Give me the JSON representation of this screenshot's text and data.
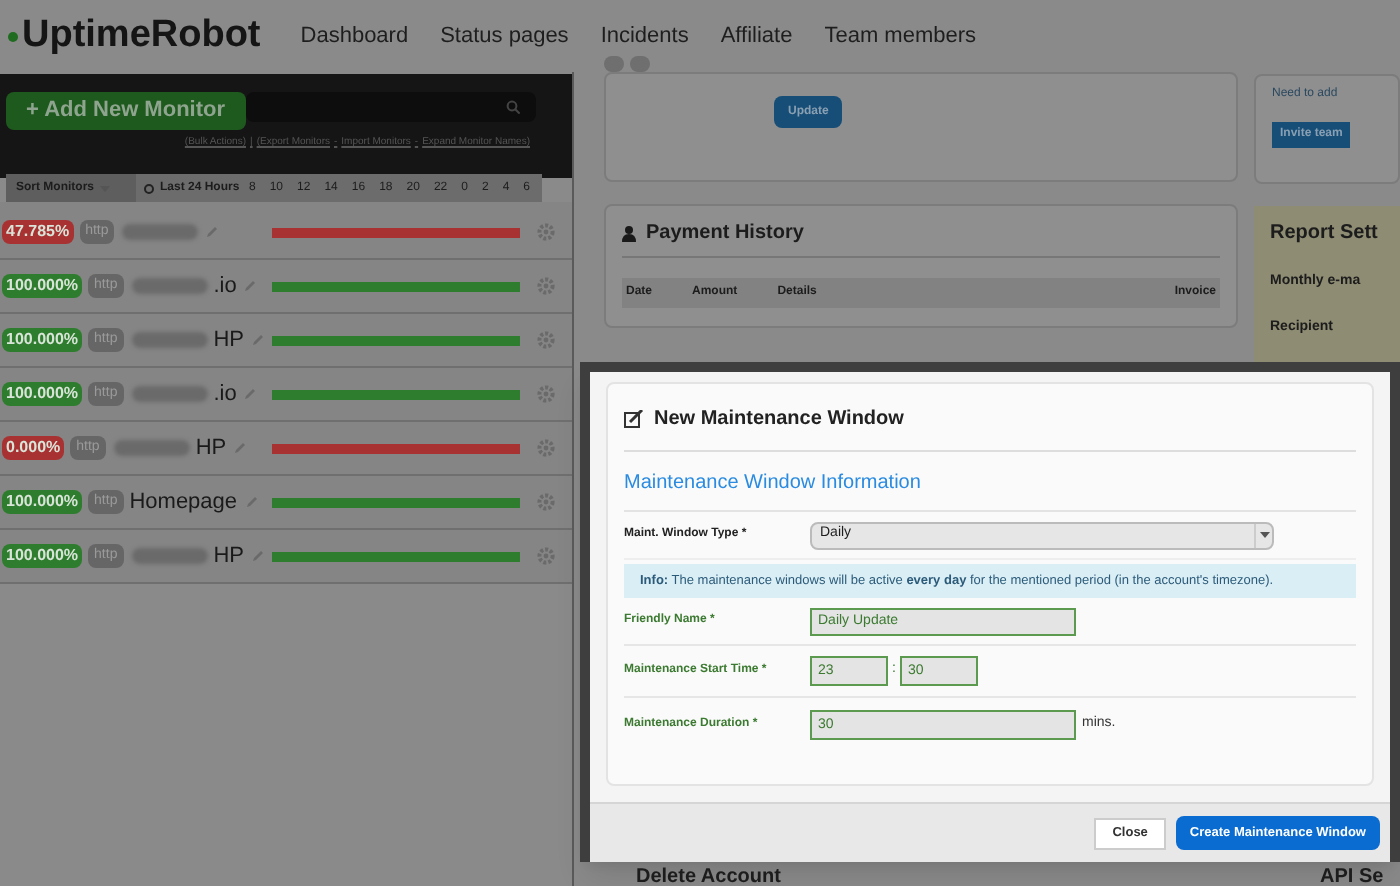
{
  "brand": "UptimeRobot",
  "nav": [
    "Dashboard",
    "Status pages",
    "Incidents",
    "Affiliate",
    "Team members"
  ],
  "monitors_panel": {
    "add_button": "+ Add New Monitor",
    "links": [
      "(Bulk Actions)",
      "|",
      "(Export Monitors",
      "-",
      "Import Monitors",
      "-",
      "Expand Monitor Names)"
    ],
    "sort_button": "Sort Monitors",
    "range": "Last 24 Hours",
    "hours": [
      "8",
      "10",
      "12",
      "14",
      "16",
      "18",
      "20",
      "22",
      "0",
      "2",
      "4",
      "6"
    ],
    "monitors": [
      {
        "uptime": "47.785%",
        "color": "#a83232",
        "protocol": "http",
        "blurred": true
      },
      {
        "uptime": "100.000%",
        "color": "#2e7d2e",
        "protocol": "http",
        "blurred": true,
        "name_visible": ".io"
      },
      {
        "uptime": "100.000%",
        "color": "#2e7d2e",
        "protocol": "http",
        "blurred": true,
        "name_visible": "HP"
      },
      {
        "uptime": "100.000%",
        "color": "#2e7d2e",
        "protocol": "http",
        "blurred": true,
        "name_visible": ".io"
      },
      {
        "uptime": "0.000%",
        "color": "#a83232",
        "protocol": "http",
        "blurred": true,
        "name_visible": "HP"
      },
      {
        "uptime": "100.000%",
        "color": "#2e7d2e",
        "protocol": "http",
        "blurred": false,
        "name_visible": "Homepage"
      },
      {
        "uptime": "100.000%",
        "color": "#2e7d2e",
        "protocol": "http",
        "blurred": true,
        "name_visible": "HP"
      }
    ]
  },
  "update_button": "Update",
  "payment_history": {
    "title": "Payment History",
    "columns": [
      "Date",
      "Amount",
      "Details",
      "Invoice"
    ]
  },
  "team_box": {
    "text": "Need to add",
    "button": "Invite team"
  },
  "report_settings": {
    "title": "Report Sett",
    "rows": [
      "Monthly e-ma",
      "Recipient"
    ]
  },
  "delete_account": "Delete Account",
  "api_settings": "API Se",
  "modal": {
    "title": "New Maintenance Window",
    "section": "Maintenance Window Information",
    "type_label": "Maint. Window Type *",
    "type_value": "Daily",
    "info": "**Info:** The maintenance windows will be active **every day** for the mentioned period (in the account's timezone).",
    "name_label": "Friendly Name *",
    "name_value": "Daily Update",
    "start_label": "Maintenance Start Time *",
    "start_hour": "23",
    "separator": ":",
    "start_minute": "30",
    "duration_label": "Maintenance Duration *",
    "duration_value": "30",
    "duration_unit": "mins.",
    "close_button": "Close",
    "create_button": "Create Maintenance Window"
  }
}
